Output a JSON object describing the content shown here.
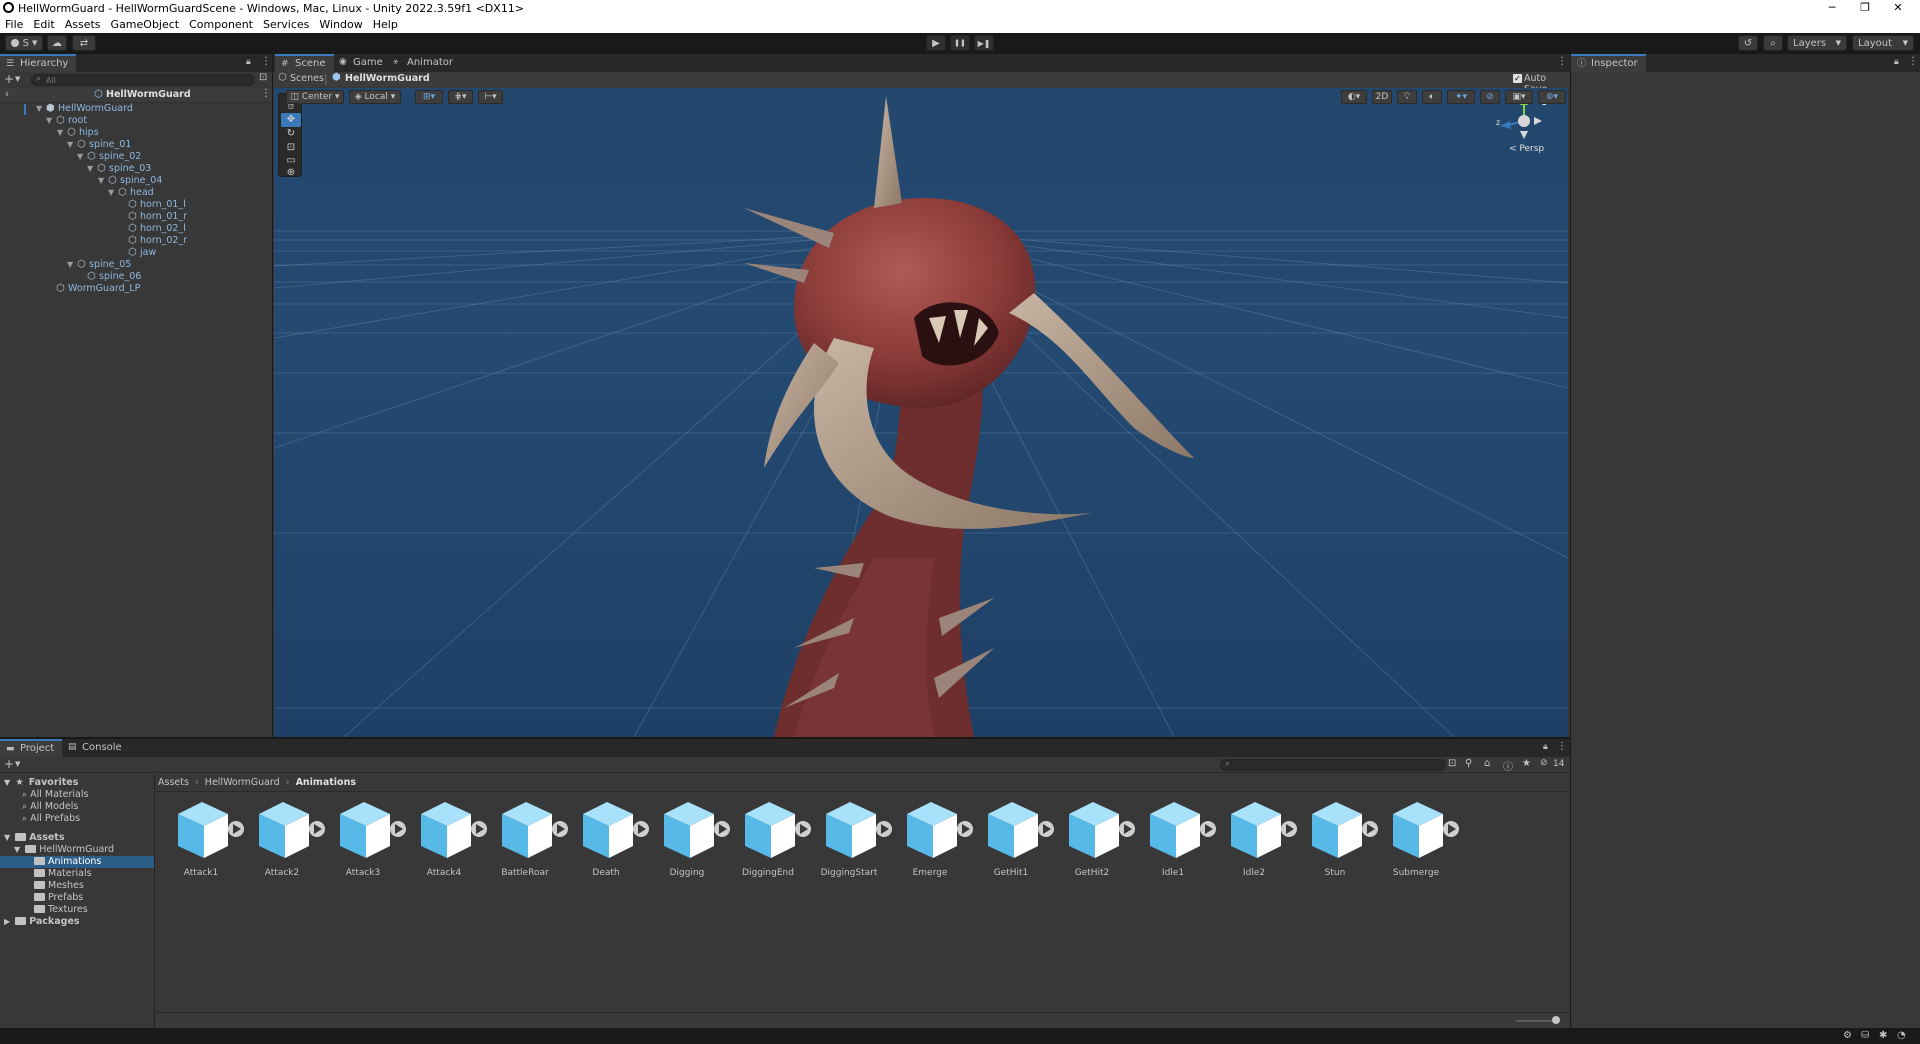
{
  "window": {
    "title": "HellWormGuard - HellWormGuardScene - Windows, Mac, Linux - Unity 2022.3.59f1 <DX11>",
    "minimize": "─",
    "restore": "❐",
    "close": "✕"
  },
  "menu": [
    "File",
    "Edit",
    "Assets",
    "GameObject",
    "Component",
    "Services",
    "Window",
    "Help"
  ],
  "toolbar": {
    "account": "S",
    "play": "▶",
    "pause": "❚❚",
    "step": "▶❚",
    "layers": "Layers",
    "layout": "Layout"
  },
  "hierarchy": {
    "tab": "Hierarchy",
    "search_placeholder": "All",
    "scene": "HellWormGuard",
    "items": [
      {
        "label": "HellWormGuard"
      },
      {
        "label": "root"
      },
      {
        "label": "hips"
      },
      {
        "label": "spine_01"
      },
      {
        "label": "spine_02"
      },
      {
        "label": "spine_03"
      },
      {
        "label": "spine_04"
      },
      {
        "label": "head"
      },
      {
        "label": "horn_01_l"
      },
      {
        "label": "horn_01_r"
      },
      {
        "label": "horn_02_l"
      },
      {
        "label": "horn_02_r"
      },
      {
        "label": "jaw"
      },
      {
        "label": "spine_05"
      },
      {
        "label": "spine_06"
      },
      {
        "label": "WormGuard_LP"
      }
    ]
  },
  "scene_view": {
    "tabs": [
      "Scene",
      "Game",
      "Animator"
    ],
    "breadcrumb_root": "Scenes",
    "breadcrumb_current": "HellWormGuard",
    "auto_save": "Auto Save",
    "pivot": "Center",
    "space": "Local",
    "mode_2d": "2D",
    "persp": "< Persp",
    "gizmo_y": "y",
    "gizmo_z": "z"
  },
  "inspector": {
    "tab": "Inspector"
  },
  "project": {
    "tabs": [
      "Project",
      "Console"
    ],
    "favorites_label": "Favorites",
    "favorites": [
      "All Materials",
      "All Models",
      "All Prefabs"
    ],
    "assets_label": "Assets",
    "hellworm_folder": "HellWormGuard",
    "subfolders": [
      "Animations",
      "Materials",
      "Meshes",
      "Prefabs",
      "Textures"
    ],
    "packages_label": "Packages",
    "breadcrumb": [
      "Assets",
      "HellWormGuard",
      "Animations"
    ],
    "hidden_count": "14",
    "asset_items": [
      "Attack1",
      "Attack2",
      "Attack3",
      "Attack4",
      "BattleRoar",
      "Death",
      "Digging",
      "DiggingEnd",
      "DiggingStart",
      "Emerge",
      "GetHit1",
      "GetHit2",
      "Idle1",
      "Idle2",
      "Stun",
      "Submerge"
    ]
  },
  "colors": {
    "scene_bg": "#22456b",
    "selection": "#2c5d87",
    "accent": "#3a79bb",
    "asset_icon": "#6cc3ee"
  }
}
